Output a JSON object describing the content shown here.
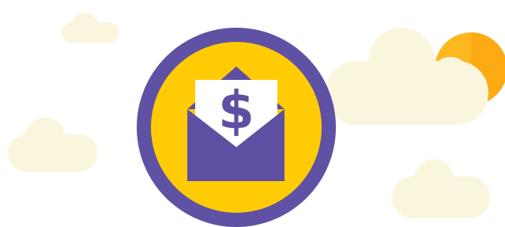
{
  "illustration": {
    "icon": "money-envelope-icon",
    "symbol": "$",
    "colors": {
      "background": "#ffffff",
      "cloud": "#faf6dd",
      "sun_light": "#fcb021",
      "sun_dark": "#fbbf24",
      "ring": "#5e4fa2",
      "badge_fill": "#ffcc00",
      "envelope": "#5e4fa2",
      "letter": "#ffffff",
      "dollar": "#5e4fa2"
    }
  }
}
